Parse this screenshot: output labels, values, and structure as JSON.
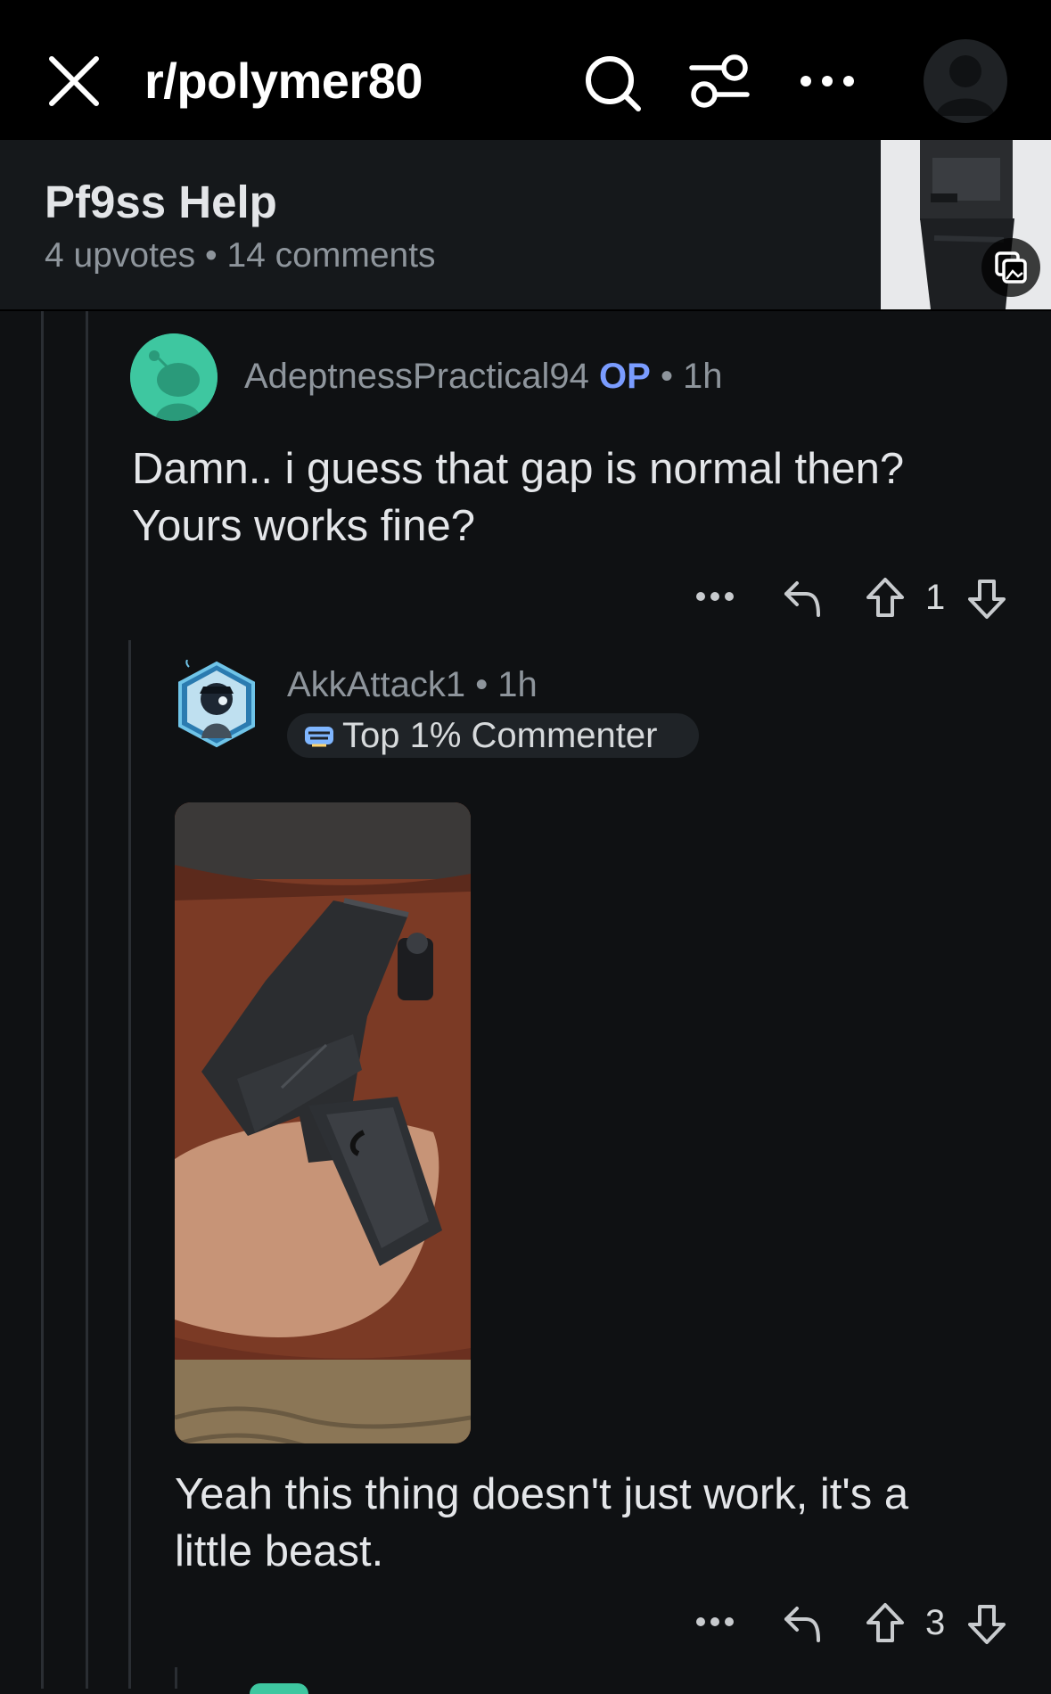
{
  "header": {
    "subreddit": "r/polymer80",
    "icons": [
      "close-icon",
      "search-icon",
      "filter-icon",
      "more-icon",
      "avatar-icon"
    ]
  },
  "post": {
    "title": "Pf9ss Help",
    "meta": "4 upvotes • 14 comments",
    "thumbnail_badge": "gallery-icon"
  },
  "comments": [
    {
      "author": "AdeptnessPractical94",
      "op_tag": "OP",
      "time": " • 1h",
      "body_line1": "Damn.. i guess that gap is normal then?",
      "body_line2": "Yours works fine?",
      "votes": "1"
    },
    {
      "author": "AkkAttack1",
      "time": " • 1h",
      "flair": "Top 1% Commenter",
      "body_line1": "Yeah this thing doesn't just work, it's a",
      "body_line2": "little beast.",
      "votes": "3"
    }
  ],
  "colors": {
    "background": "#0f1113",
    "topbar": "#000000",
    "op_accent": "#7a9cff",
    "avatar_accent": "#3ec7a0"
  }
}
